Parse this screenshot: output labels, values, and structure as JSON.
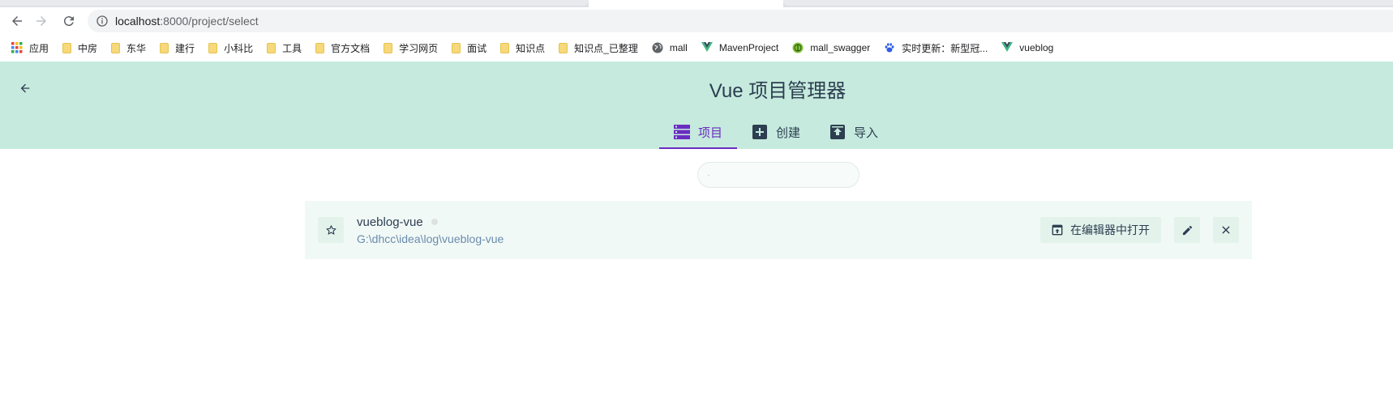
{
  "browser": {
    "url_host": "localhost",
    "url_path": ":8000/project/select"
  },
  "bookmarks": [
    {
      "label": "应用",
      "icon": "apps-grid-icon"
    },
    {
      "label": "中房",
      "icon": "folder-icon"
    },
    {
      "label": "东华",
      "icon": "folder-icon"
    },
    {
      "label": "建行",
      "icon": "folder-icon"
    },
    {
      "label": "小科比",
      "icon": "folder-icon"
    },
    {
      "label": "工具",
      "icon": "folder-icon"
    },
    {
      "label": "官方文档",
      "icon": "folder-icon"
    },
    {
      "label": "学习网页",
      "icon": "folder-icon"
    },
    {
      "label": "面试",
      "icon": "folder-icon"
    },
    {
      "label": "知识点",
      "icon": "folder-icon"
    },
    {
      "label": "知识点_已整理",
      "icon": "folder-icon"
    },
    {
      "label": "mall",
      "icon": "globe-icon"
    },
    {
      "label": "MavenProject",
      "icon": "vue-logo-icon"
    },
    {
      "label": "mall_swagger",
      "icon": "swagger-icon"
    },
    {
      "label": "实时更新：新型冠...",
      "icon": "baidu-paw-icon"
    },
    {
      "label": "vueblog",
      "icon": "vue-logo-icon"
    }
  ],
  "header": {
    "title": "Vue 项目管理器",
    "tabs": [
      {
        "label": "项目",
        "icon": "projects-list-icon",
        "active": true
      },
      {
        "label": "创建",
        "icon": "add-box-icon",
        "active": false
      },
      {
        "label": "导入",
        "icon": "import-icon",
        "active": false
      }
    ]
  },
  "search": {
    "placeholder": "",
    "value": ""
  },
  "project": {
    "name": "vueblog-vue",
    "path": "G:\\dhcc\\idea\\log\\vueblog-vue",
    "open_in_editor_label": "在编辑器中打开"
  },
  "colors": {
    "header_bg": "#c6eadd",
    "accent": "#6a2cc2",
    "row_bg": "#f1f9f6",
    "button_bg": "#e3f3ec",
    "path_text": "#6a8bad"
  }
}
